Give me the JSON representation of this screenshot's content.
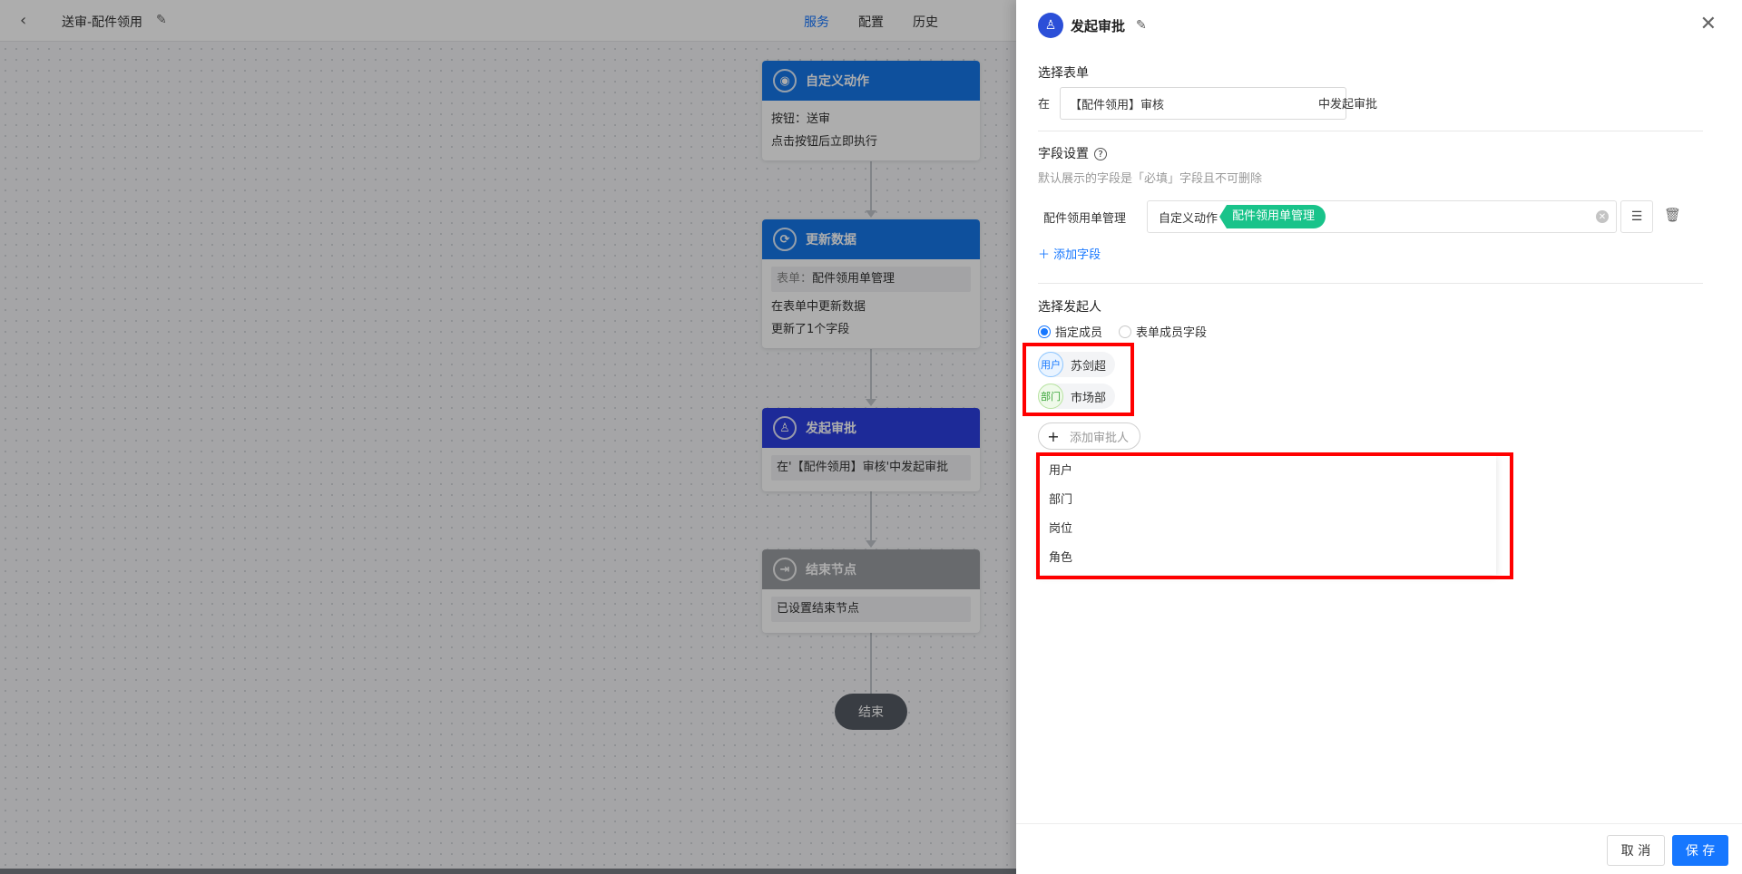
{
  "topbar": {
    "title": "送审-配件领用",
    "tabs": [
      {
        "label": "服务",
        "active": true
      },
      {
        "label": "配置",
        "active": false
      },
      {
        "label": "历史",
        "active": false
      }
    ]
  },
  "workflow": {
    "nodes": [
      {
        "title": "自定义动作",
        "color": "#1677e8",
        "lines": [
          "按钮：送审",
          "点击按钮后立即执行"
        ]
      },
      {
        "title": "更新数据",
        "color": "#1677e8",
        "form_key": "表单：",
        "form_value": "配件领用单管理",
        "lines": [
          "在表单中更新数据",
          "更新了1个字段"
        ]
      },
      {
        "title": "发起审批",
        "color": "#2b3fe0",
        "grey_line": "在'【配件领用】审核'中发起审批"
      },
      {
        "title": "结束节点",
        "color": "#9a9ca1",
        "grey_line": "已设置结束节点"
      }
    ],
    "end_label": "结束"
  },
  "drawer": {
    "title": "发起审批",
    "select_form": {
      "label": "选择表单",
      "prefix": "在",
      "value": "【配件领用】审核",
      "suffix": "中发起审批"
    },
    "field_settings": {
      "label": "字段设置",
      "hint": "默认展示的字段是「必填」字段且不可删除",
      "field_label": "配件领用单管理",
      "chip_plain": "自定义动作",
      "chip_green": "配件领用单管理",
      "add_field": "添加字段"
    },
    "initiator": {
      "label": "选择发起人",
      "radio_options": [
        {
          "label": "指定成员",
          "checked": true
        },
        {
          "label": "表单成员字段",
          "checked": false
        }
      ],
      "members": [
        {
          "type": "用户",
          "name": "苏剑超"
        },
        {
          "type": "部门",
          "name": "市场部"
        }
      ],
      "add_approver": "添加审批人",
      "dropdown_options": [
        "用户",
        "部门",
        "岗位",
        "角色"
      ]
    },
    "footer": {
      "cancel": "取 消",
      "save": "保 存"
    }
  },
  "colors": {
    "primary": "#1677ff",
    "green_chip": "#19c38a",
    "highlight_red": "#ff0000"
  }
}
